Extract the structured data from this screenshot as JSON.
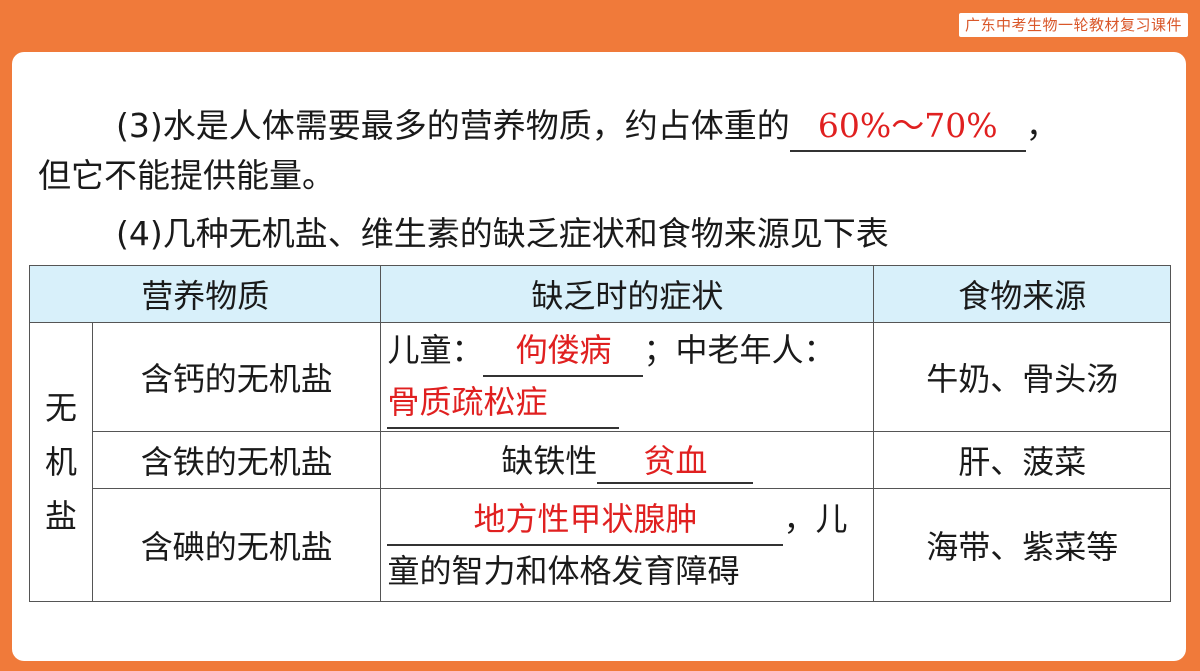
{
  "header": {
    "badge": "广东中考生物一轮教材复习课件"
  },
  "paragraphs": {
    "p3_prefix": "(3)水是人体需要最多的营养物质，约占体重的",
    "p3_answer": "60%～70%",
    "p3_suffix": "，",
    "p3_line2": "但它不能提供能量。",
    "p4": "(4)几种无机盐、维生素的缺乏症状和食物来源见下表"
  },
  "table": {
    "headers": [
      "营养物质",
      "缺乏时的症状",
      "食物来源"
    ],
    "group_label": "无机盐",
    "rows": [
      {
        "name": "含钙的无机盐",
        "sym_a": "儿童：",
        "ans_a": "佝偻病",
        "sym_b": "；中老年人：",
        "ans_b": "骨质疏松症",
        "source": "牛奶、骨头汤"
      },
      {
        "name": "含铁的无机盐",
        "sym_a": "缺铁性",
        "ans_a": "贫血",
        "source": "肝、菠菜"
      },
      {
        "name": "含碘的无机盐",
        "ans_a": "地方性甲状腺肿",
        "sym_b": "，儿",
        "sym_c": "童的智力和体格发育障碍",
        "source": "海带、紫菜等"
      }
    ]
  }
}
